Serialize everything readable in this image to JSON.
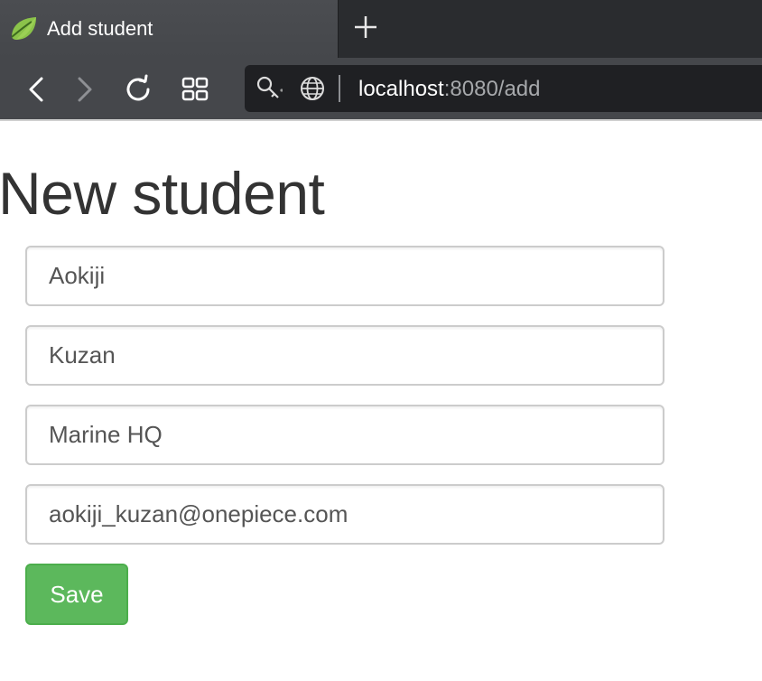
{
  "browser": {
    "tab": {
      "title": "Add student",
      "favicon": "spring-leaf-icon"
    },
    "toolbar": {
      "back": "chevron-left-icon",
      "forward": "chevron-right-icon",
      "reload": "reload-icon",
      "speed_dial": "grid-icon"
    },
    "address": {
      "host": "localhost",
      "rest": ":8080/add",
      "site_info": "key-icon",
      "globe": "globe-icon"
    }
  },
  "page": {
    "title": "New student",
    "fields": [
      {
        "value": "Aokiji"
      },
      {
        "value": "Kuzan"
      },
      {
        "value": "Marine HQ"
      },
      {
        "value": "aokiji_kuzan@onepiece.com"
      }
    ],
    "save_label": "Save"
  },
  "colors": {
    "save_button": "#5cb85c",
    "title_text": "#333333",
    "chrome_dark": "#45474b"
  }
}
